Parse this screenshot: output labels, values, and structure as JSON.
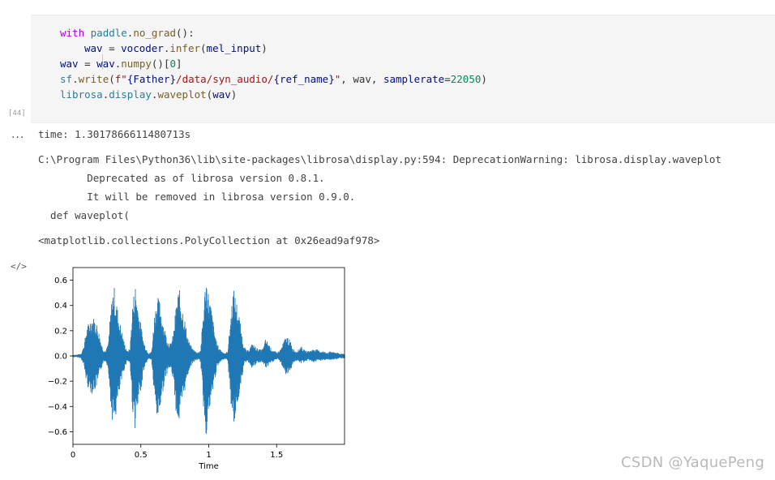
{
  "cell": {
    "execution_count": "[44]",
    "code": {
      "line1": {
        "kw": "with",
        "mod": "paddle",
        "dot": ".",
        "fn": "no_grad",
        "rest": "():"
      },
      "line2": {
        "var1": "wav",
        "eq": " = ",
        "var2": "vocoder",
        "dot": ".",
        "fn": "infer",
        "open": "(",
        "arg": "mel_input",
        "close": ")"
      },
      "line3": {
        "var1": "wav",
        "eq": " = ",
        "var2": "wav",
        "dot": ".",
        "fn": "numpy",
        "mid": "()[",
        "num": "0",
        "close": "]"
      },
      "line4": {
        "mod": "sf",
        "dot": ".",
        "fn": "write",
        "open": "(",
        "str1": "f\"",
        "brace1": "{Father}",
        "str2": "/data/syn_audio/",
        "brace2": "{ref_name}",
        "str3": "\"",
        "mid": ", wav, ",
        "kwarg": "samplerate",
        "eq": "=",
        "num": "22050",
        "close": ")"
      },
      "line5": {
        "mod": "librosa",
        "dot1": ".",
        "mod2": "display",
        "dot2": ".",
        "fn": "waveplot",
        "open": "(",
        "arg": "wav",
        "close": ")"
      }
    }
  },
  "outputs": {
    "more_icon": "...",
    "time_line": "time: 1.3017866611480713s",
    "warning_lines": [
      "C:\\Program Files\\Python36\\lib\\site-packages\\librosa\\display.py:594: DeprecationWarning: librosa.display.waveplot",
      "        Deprecated as of librosa version 0.8.1.",
      "        It will be removed in librosa version 0.9.0.",
      "  def waveplot("
    ],
    "repr_line": "<matplotlib.collections.PolyCollection at 0x26ead9af978>",
    "code_icon": "</>"
  },
  "chart_data": {
    "type": "area",
    "title": "",
    "xlabel": "Time",
    "ylabel": "",
    "xlim": [
      0,
      2.0
    ],
    "ylim": [
      -0.7,
      0.7
    ],
    "x_ticks": [
      "0",
      "0.5",
      "1",
      "1.5"
    ],
    "x_tick_values": [
      0,
      0.5,
      1,
      1.5
    ],
    "y_ticks": [
      "0.6",
      "0.4",
      "0.2",
      "0.0",
      "−0.2",
      "−0.4",
      "−0.6"
    ],
    "y_tick_values": [
      0.6,
      0.4,
      0.2,
      0.0,
      -0.2,
      -0.4,
      -0.6
    ],
    "series_color": "#1f77b4",
    "envelope": {
      "x": [
        0,
        0.03,
        0.06,
        0.08,
        0.1,
        0.12,
        0.14,
        0.16,
        0.18,
        0.2,
        0.22,
        0.24,
        0.26,
        0.28,
        0.3,
        0.32,
        0.34,
        0.36,
        0.38,
        0.4,
        0.42,
        0.44,
        0.46,
        0.48,
        0.5,
        0.52,
        0.54,
        0.56,
        0.58,
        0.6,
        0.62,
        0.64,
        0.66,
        0.68,
        0.7,
        0.72,
        0.74,
        0.76,
        0.78,
        0.8,
        0.82,
        0.84,
        0.86,
        0.88,
        0.9,
        0.92,
        0.94,
        0.96,
        0.98,
        1.0,
        1.02,
        1.04,
        1.06,
        1.08,
        1.1,
        1.12,
        1.14,
        1.16,
        1.18,
        1.2,
        1.22,
        1.24,
        1.26,
        1.28,
        1.3,
        1.32,
        1.34,
        1.36,
        1.38,
        1.4,
        1.42,
        1.44,
        1.46,
        1.48,
        1.5,
        1.52,
        1.54,
        1.56,
        1.58,
        1.6,
        1.62,
        1.64,
        1.66,
        1.68,
        1.7,
        1.72,
        1.74,
        1.76,
        1.78,
        1.8,
        1.82,
        1.84,
        1.86,
        1.88,
        1.9,
        1.92,
        1.94,
        1.96,
        1.98,
        2.0
      ],
      "upper": [
        0.01,
        0.01,
        0.02,
        0.08,
        0.22,
        0.28,
        0.32,
        0.3,
        0.25,
        0.15,
        0.06,
        0.04,
        0.1,
        0.4,
        0.58,
        0.44,
        0.3,
        0.2,
        0.1,
        0.04,
        0.06,
        0.44,
        0.58,
        0.4,
        0.26,
        0.12,
        0.06,
        0.02,
        0.04,
        0.34,
        0.48,
        0.44,
        0.3,
        0.2,
        0.12,
        0.1,
        0.18,
        0.42,
        0.55,
        0.44,
        0.32,
        0.18,
        0.1,
        0.06,
        0.04,
        0.03,
        0.05,
        0.36,
        0.66,
        0.5,
        0.38,
        0.22,
        0.1,
        0.06,
        0.04,
        0.02,
        0.04,
        0.3,
        0.55,
        0.46,
        0.36,
        0.2,
        0.08,
        0.04,
        0.06,
        0.1,
        0.08,
        0.06,
        0.05,
        0.06,
        0.14,
        0.1,
        0.06,
        0.04,
        0.03,
        0.04,
        0.08,
        0.14,
        0.16,
        0.12,
        0.06,
        0.04,
        0.05,
        0.08,
        0.05,
        0.04,
        0.04,
        0.05,
        0.06,
        0.05,
        0.04,
        0.04,
        0.03,
        0.03,
        0.04,
        0.03,
        0.03,
        0.02,
        0.02,
        0.02
      ],
      "lower": [
        -0.01,
        -0.01,
        -0.02,
        -0.08,
        -0.22,
        -0.28,
        -0.3,
        -0.28,
        -0.24,
        -0.14,
        -0.06,
        -0.04,
        -0.1,
        -0.44,
        -0.58,
        -0.46,
        -0.32,
        -0.2,
        -0.1,
        -0.04,
        -0.06,
        -0.46,
        -0.6,
        -0.42,
        -0.28,
        -0.12,
        -0.06,
        -0.02,
        -0.04,
        -0.36,
        -0.52,
        -0.44,
        -0.3,
        -0.18,
        -0.12,
        -0.1,
        -0.2,
        -0.46,
        -0.56,
        -0.44,
        -0.3,
        -0.18,
        -0.1,
        -0.06,
        -0.04,
        -0.03,
        -0.05,
        -0.4,
        -0.64,
        -0.5,
        -0.36,
        -0.22,
        -0.1,
        -0.06,
        -0.04,
        -0.02,
        -0.04,
        -0.34,
        -0.58,
        -0.46,
        -0.34,
        -0.2,
        -0.08,
        -0.04,
        -0.06,
        -0.1,
        -0.08,
        -0.06,
        -0.05,
        -0.06,
        -0.1,
        -0.08,
        -0.06,
        -0.04,
        -0.03,
        -0.04,
        -0.08,
        -0.14,
        -0.16,
        -0.12,
        -0.06,
        -0.04,
        -0.05,
        -0.06,
        -0.05,
        -0.04,
        -0.04,
        -0.05,
        -0.05,
        -0.04,
        -0.04,
        -0.04,
        -0.03,
        -0.03,
        -0.04,
        -0.03,
        -0.03,
        -0.02,
        -0.02,
        -0.02
      ]
    }
  },
  "watermark": "CSDN @YaquePeng"
}
